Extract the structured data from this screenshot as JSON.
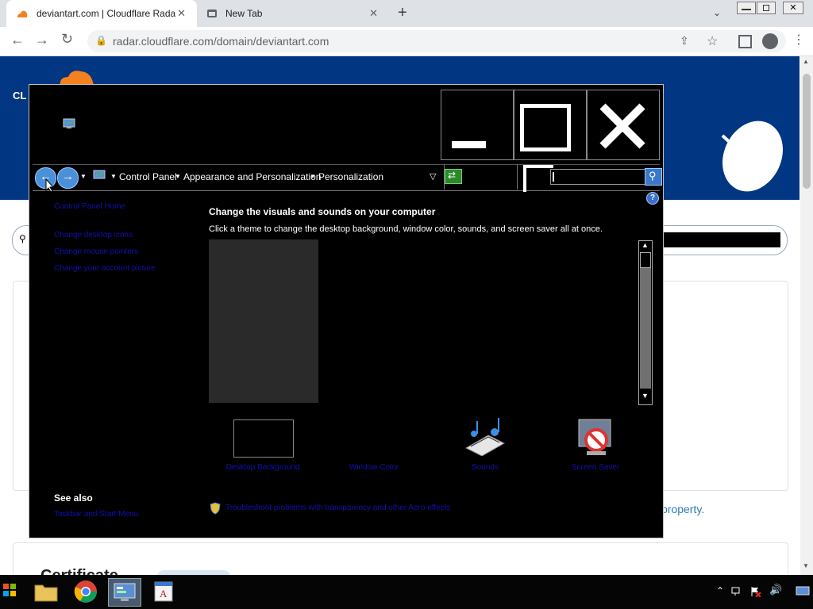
{
  "browser": {
    "tabs": [
      {
        "title": "deviantart.com | Cloudflare Radar",
        "active": true
      },
      {
        "title": "New Tab",
        "active": false
      }
    ],
    "url": "radar.cloudflare.com/domain/deviantart.com"
  },
  "page": {
    "brand_fragment": "CL",
    "property_fragment": "property.",
    "certificate_fragment": "Certificate"
  },
  "window": {
    "breadcrumb": [
      "Control Panel",
      "Appearance and Personalization",
      "Personalization"
    ],
    "left_links": [
      "Control Panel Home",
      "Change desktop icons",
      "Change mouse pointers",
      "Change your account picture"
    ],
    "see_also_heading": "See also",
    "see_also_links": [
      "Taskbar and Start Menu"
    ],
    "heading": "Change the visuals and sounds on your computer",
    "subheading": "Click a theme to change the desktop background, window color, sounds, and screen saver all at once.",
    "bottom_items": [
      "Desktop Background",
      "Window Color",
      "Sounds",
      "Screen Saver"
    ],
    "troubleshoot_link": "Troubleshoot problems with transparency and other Aero effects"
  },
  "colors": {
    "hero": "#003682",
    "link_dark": "#1010b0",
    "window_bg": "#000000"
  }
}
